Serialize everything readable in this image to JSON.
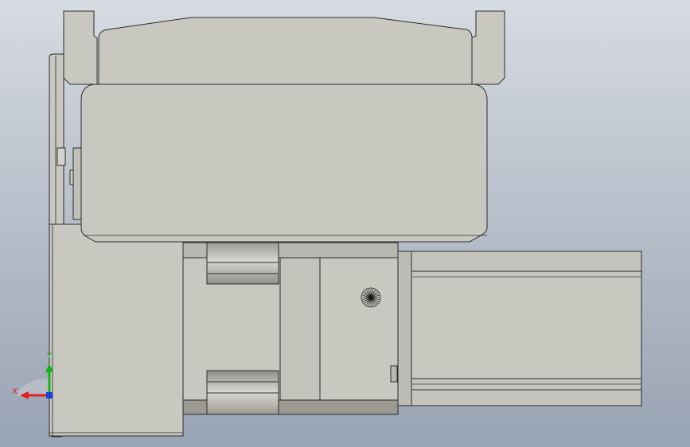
{
  "viewport": {
    "background_top": "#d7dbe2",
    "background_bottom": "#98a3b3"
  },
  "model": {
    "part_fill": "#c8c8c0",
    "part_light": "#d2d2ca",
    "part_dark": "#a6a69e",
    "part_shadow": "#7d7d76",
    "edge_color": "#2b2b2b",
    "feature_icon": "spoked-hole-icon"
  },
  "triad": {
    "x_label": "X",
    "y_label": "Y",
    "x_color": "#e21e1e",
    "y_color": "#12b312",
    "z_color": "#1f3fe0"
  }
}
